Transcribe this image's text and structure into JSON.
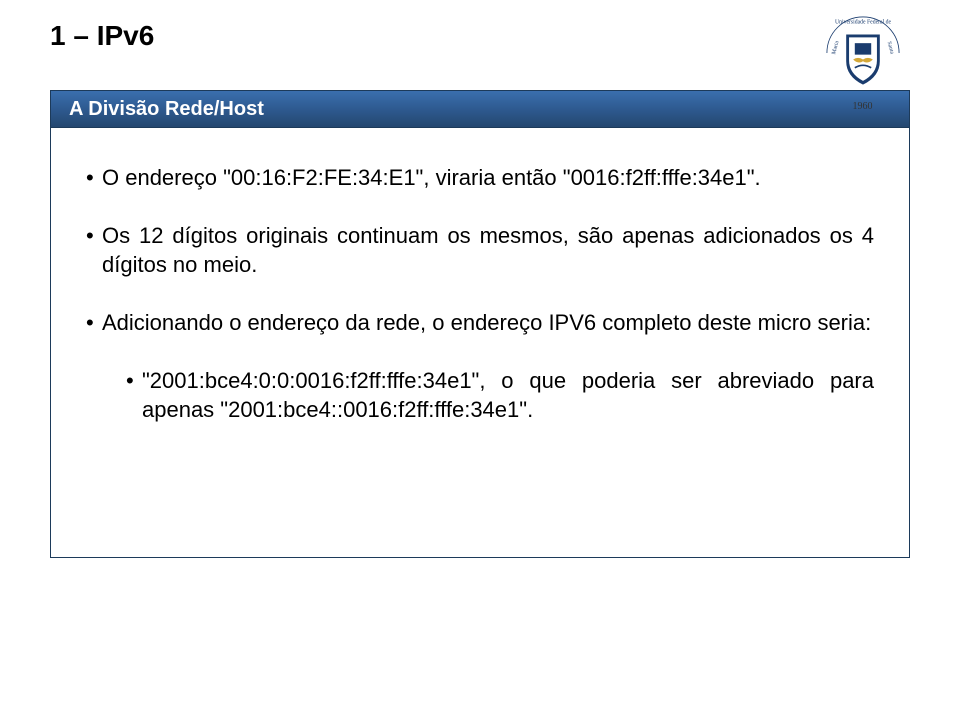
{
  "title": "1 – IPv6",
  "logo": {
    "alt": "Universidade Federal de Santa Maria",
    "year": "1960"
  },
  "section": {
    "heading": "A Divisão Rede/Host"
  },
  "bullets": [
    {
      "text": "O endereço \"00:16:F2:FE:34:E1\", viraria então \"0016:f2ff:fffe:34e1\"."
    },
    {
      "text": "Os 12 dígitos originais continuam os mesmos, são apenas adicionados os 4 dígitos no meio."
    },
    {
      "text": "Adicionando o endereço da rede, o endereço IPV6 completo deste micro seria:"
    },
    {
      "text": "\"2001:bce4:0:0:0016:f2ff:fffe:34e1\", o que poderia ser abreviado para apenas \"2001:bce4::0016:f2ff:fffe:34e1\".",
      "sub": true
    }
  ]
}
